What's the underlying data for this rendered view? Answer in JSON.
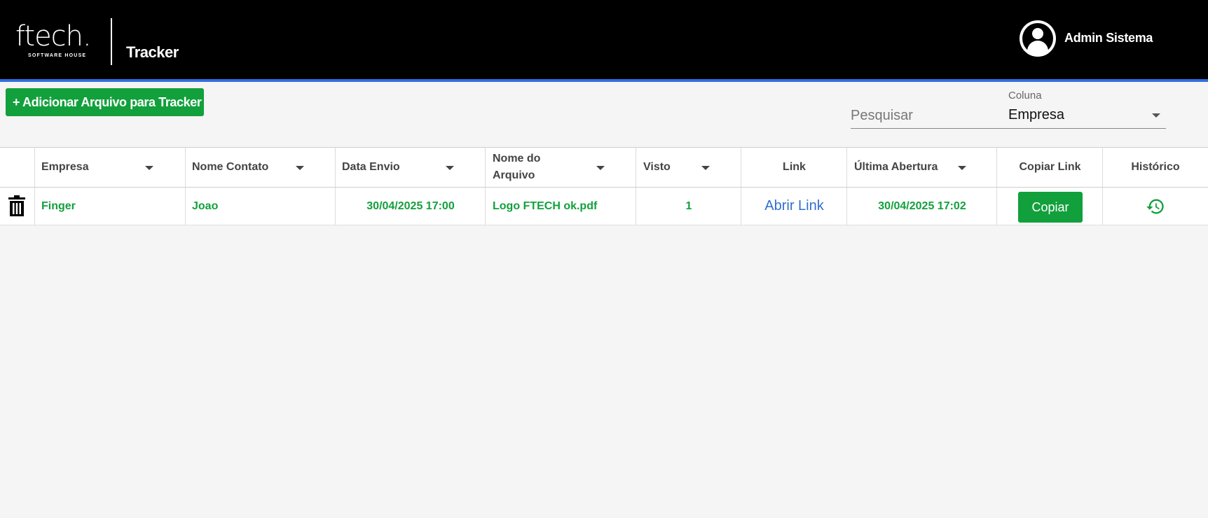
{
  "header": {
    "logo_word": "ftech.",
    "logo_sub": "SOFTWARE HOUSE",
    "app_title": "Tracker",
    "user_name": "Admin Sistema"
  },
  "toolbar": {
    "add_button_label": "+ Adicionar Arquivo para Tracker",
    "search_placeholder": "Pesquisar",
    "column_select_label": "Coluna",
    "column_select_value": "Empresa"
  },
  "table": {
    "columns": [
      {
        "label": "Empresa"
      },
      {
        "label": "Nome Contato"
      },
      {
        "label": "Data Envio"
      },
      {
        "label": "Nome do Arquivo"
      },
      {
        "label": "Visto"
      },
      {
        "label": "Link"
      },
      {
        "label": "Última Abertura"
      },
      {
        "label": "Copiar Link"
      },
      {
        "label": "Histórico"
      }
    ],
    "rows": [
      {
        "empresa": "Finger",
        "nome_contato": "Joao",
        "data_envio": "30/04/2025 17:00",
        "nome_arquivo": "Logo FTECH ok.pdf",
        "visto": "1",
        "link_label": "Abrir Link",
        "ultima_abertura": "30/04/2025 17:02",
        "copy_label": "Copiar"
      }
    ]
  },
  "colors": {
    "header_bg": "#000000",
    "accent_line": "#2f6fe0",
    "primary_green": "#12a03c",
    "link_blue": "#2f6fd0"
  },
  "icons": {
    "delete": "trash-icon",
    "history": "history-icon",
    "user": "user-avatar-icon",
    "sort": "caret-down-icon"
  }
}
